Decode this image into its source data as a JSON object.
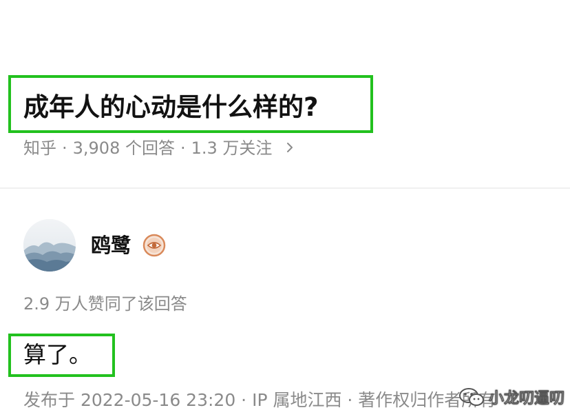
{
  "question": {
    "title": "成年人的心动是什么样的?",
    "source": "知乎",
    "sep": "·",
    "answers_count": "3,908 个回答",
    "followers_count": "1.3 万关注",
    "chevron_icon": "chevron-right-icon"
  },
  "author": {
    "name": "鸥鹭",
    "avatar_icon": "avatar-landscape",
    "badge_icon": "eye-badge-icon",
    "badge_color": "#d9895a"
  },
  "answer": {
    "votes": "2.9 万人赞同了该回答",
    "content": "算了。",
    "published": "发布于 2022-05-16 23:20 · IP 属地江西 · 著作权归作者所有"
  },
  "watermark": {
    "text": "小龙叨逼叨",
    "icon": "wechat-icon"
  },
  "colors": {
    "highlight_border": "#22c11e",
    "text_primary": "#121212",
    "text_secondary": "#8a8a8a",
    "divider": "#f0f0f0"
  }
}
